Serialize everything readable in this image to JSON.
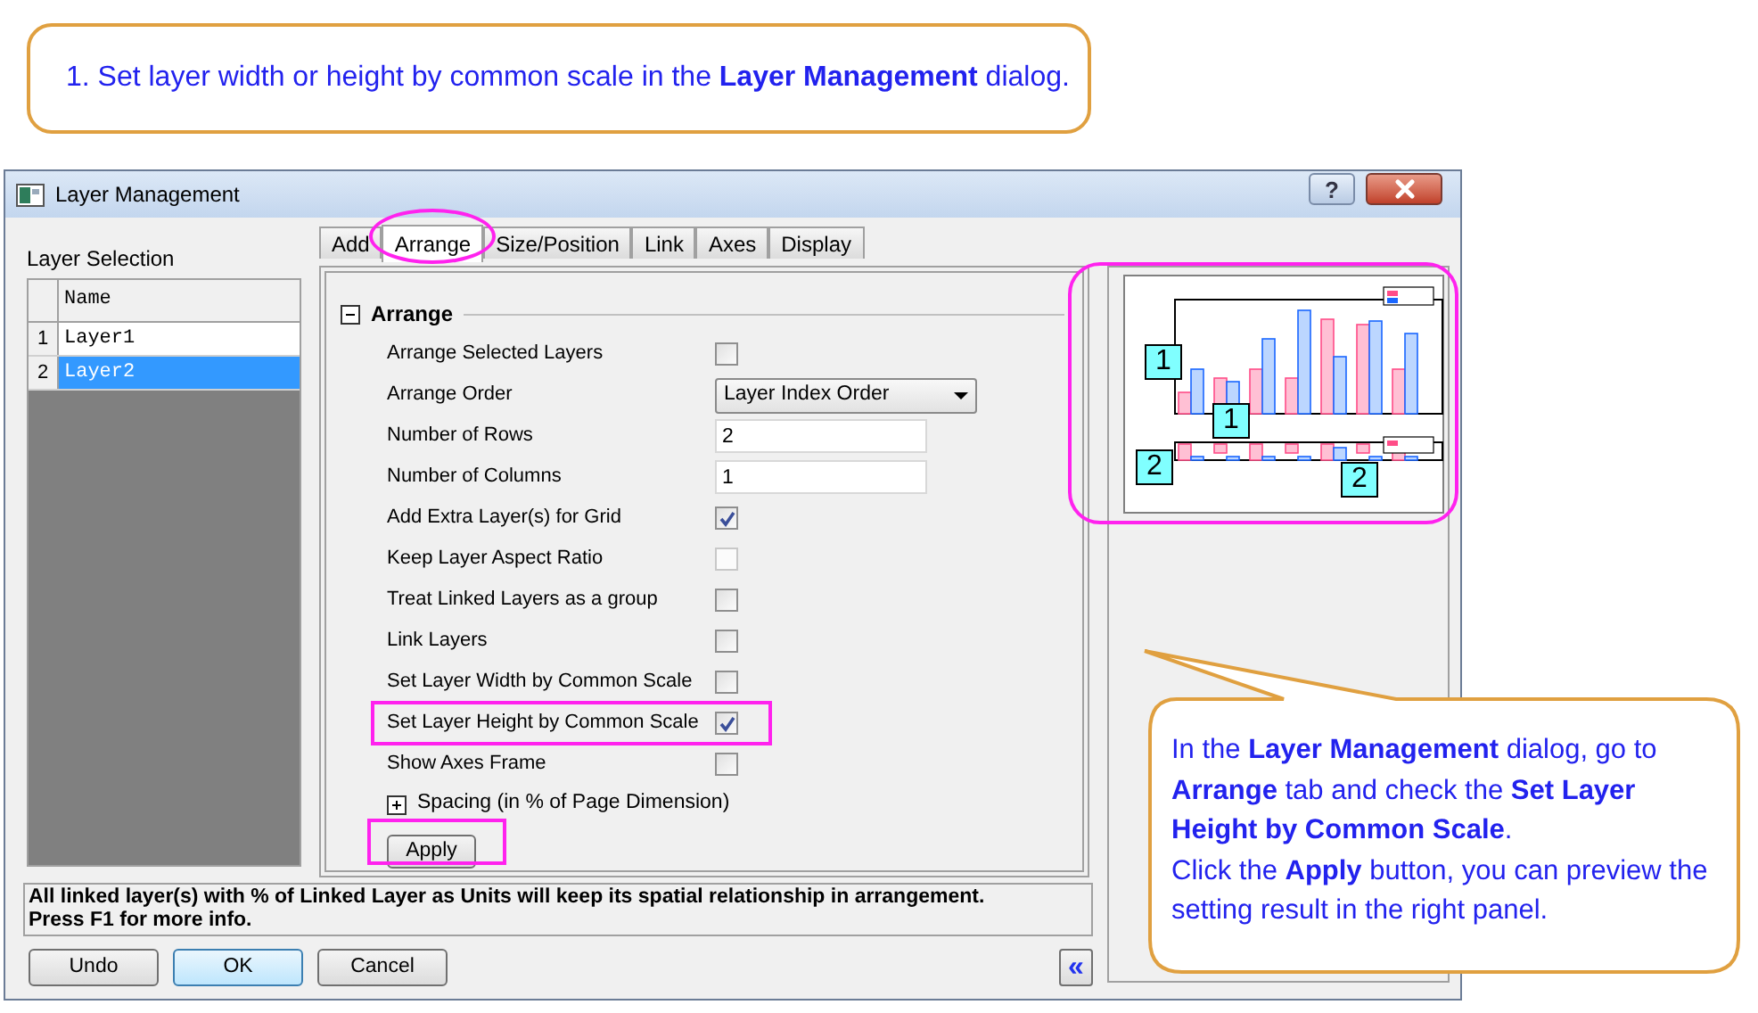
{
  "top_callout": {
    "text": "1. Set layer width or height by common scale in the **Layer Management** dialog."
  },
  "dialog": {
    "title": "Layer Management",
    "help": "?",
    "layer_selection": {
      "label": "Layer Selection",
      "column": "Name",
      "rows": [
        {
          "index": "1",
          "name": "Layer1",
          "selected": false
        },
        {
          "index": "2",
          "name": "Layer2",
          "selected": true
        }
      ]
    },
    "tabs": [
      {
        "label": "Add",
        "selected": false,
        "highlighted": false
      },
      {
        "label": "Arrange",
        "selected": true,
        "highlighted": true
      },
      {
        "label": "Size/Position",
        "selected": false,
        "highlighted": false
      },
      {
        "label": "Link",
        "selected": false,
        "highlighted": false
      },
      {
        "label": "Axes",
        "selected": false,
        "highlighted": false
      },
      {
        "label": "Display",
        "selected": false,
        "highlighted": false
      }
    ],
    "section": {
      "title": "Arrange",
      "expanded": true
    },
    "options": [
      {
        "kind": "checkbox",
        "label": "Arrange Selected Layers",
        "checked": false,
        "disabled": false,
        "highlighted": false
      },
      {
        "kind": "dropdown",
        "label": "Arrange Order",
        "value": "Layer Index Order",
        "highlighted": false
      },
      {
        "kind": "input",
        "label": "Number of Rows",
        "value": "2",
        "highlighted": false
      },
      {
        "kind": "input",
        "label": "Number of Columns",
        "value": "1",
        "highlighted": false
      },
      {
        "kind": "checkbox",
        "label": "Add Extra Layer(s) for Grid",
        "checked": true,
        "disabled": false,
        "highlighted": false
      },
      {
        "kind": "checkbox",
        "label": "Keep Layer Aspect Ratio",
        "checked": false,
        "disabled": true,
        "highlighted": false
      },
      {
        "kind": "checkbox",
        "label": "Treat Linked Layers as a group",
        "checked": false,
        "disabled": false,
        "highlighted": false
      },
      {
        "kind": "checkbox",
        "label": "Link Layers",
        "checked": false,
        "disabled": false,
        "highlighted": false
      },
      {
        "kind": "checkbox",
        "label": "Set Layer Width by Common Scale",
        "checked": false,
        "disabled": false,
        "highlighted": false
      },
      {
        "kind": "checkbox",
        "label": "Set Layer Height by Common Scale",
        "checked": true,
        "disabled": false,
        "highlighted": true
      },
      {
        "kind": "checkbox",
        "label": "Show Axes Frame",
        "checked": false,
        "disabled": false,
        "highlighted": false
      }
    ],
    "subsection": {
      "title": "Spacing (in % of Page Dimension)",
      "expanded": false
    },
    "apply_button": {
      "label": "Apply",
      "highlighted": true
    },
    "info_lines": [
      "All linked layer(s) with % of Linked Layer as Units will keep its spatial relationship in arrangement.",
      "Press F1 for more info."
    ],
    "buttons": [
      {
        "label": "Undo",
        "default": false
      },
      {
        "label": "OK",
        "default": true
      },
      {
        "label": "Cancel",
        "default": false
      }
    ],
    "collapse_button": "«",
    "preview": {
      "highlighted": true,
      "badges": [
        "1",
        "1",
        "2",
        "2"
      ]
    }
  },
  "bottom_callout": {
    "lines": [
      "In the **Layer Management** dialog, go to **Arrange** tab and check the **Set Layer Height by Common Scale**.",
      "Click the **Apply** button, you can preview the setting result in the right panel."
    ]
  }
}
